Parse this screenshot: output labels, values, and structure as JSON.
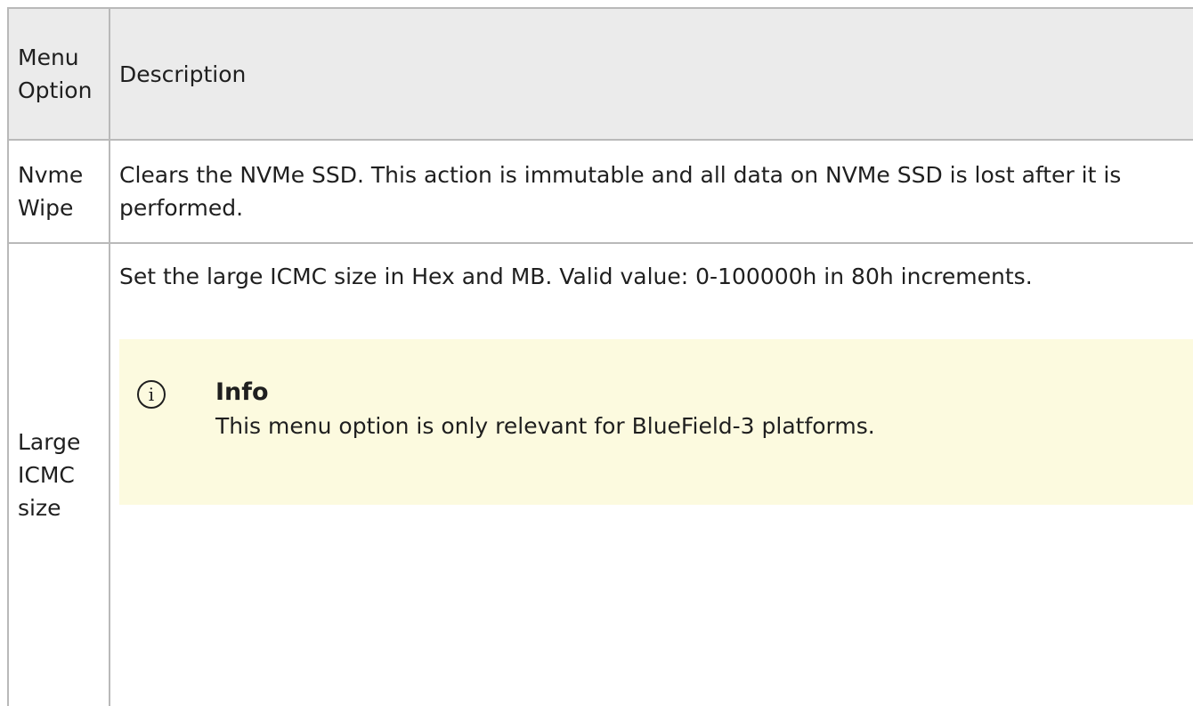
{
  "table": {
    "headers": {
      "option": "Menu Option",
      "description": "Description"
    },
    "rows": [
      {
        "option": "Nvme Wipe",
        "description": "Clears the NVMe SSD. This action is immutable and all data on NVMe SSD is lost after it is performed."
      },
      {
        "option": "Large ICMC size",
        "description": "Set the large ICMC size in Hex and MB. Valid value: 0-100000h in 80h increments.",
        "info": {
          "icon": "info-circle-icon",
          "title": "Info",
          "text": "This menu option is only relevant for BlueField-3 platforms."
        }
      }
    ]
  },
  "colors": {
    "header_bg": "#ebebeb",
    "border": "#b9b9b9",
    "info_bg": "#fcfadf"
  }
}
